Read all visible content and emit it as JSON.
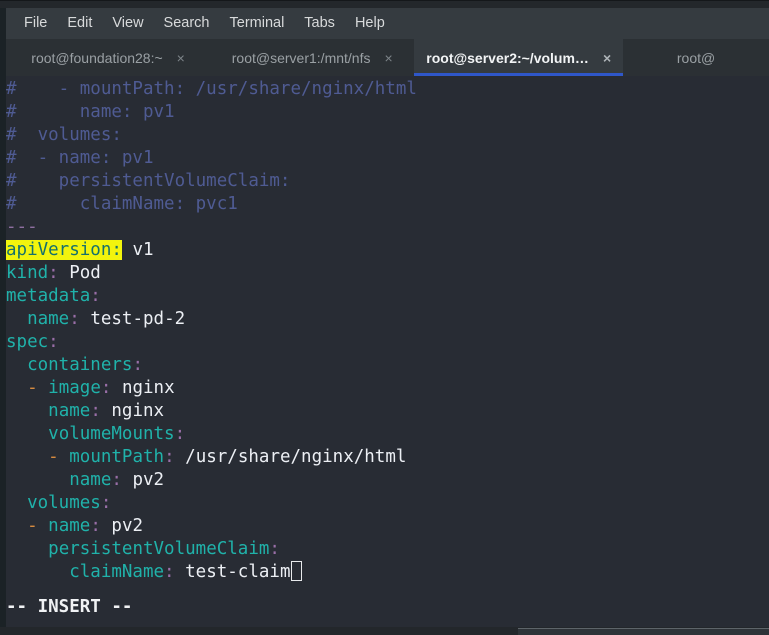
{
  "menubar": {
    "items": [
      {
        "label": "File",
        "name": "menu-file"
      },
      {
        "label": "Edit",
        "name": "menu-edit"
      },
      {
        "label": "View",
        "name": "menu-view"
      },
      {
        "label": "Search",
        "name": "menu-search"
      },
      {
        "label": "Terminal",
        "name": "menu-terminal"
      },
      {
        "label": "Tabs",
        "name": "menu-tabs"
      },
      {
        "label": "Help",
        "name": "menu-help"
      }
    ]
  },
  "tabbar": {
    "close_glyph": "×",
    "active_index": 2,
    "active_underline_color": "#2f57c9",
    "tabs": [
      {
        "label": "root@foundation28:~",
        "active": false
      },
      {
        "label": "root@server1:/mnt/nfs",
        "active": false
      },
      {
        "label": "root@server2:~/volum…",
        "active": true
      },
      {
        "label": "root@",
        "active": false
      }
    ]
  },
  "terminal": {
    "application": "vim",
    "mode_line": "-- INSERT --",
    "cursor_after_text": "test-claim",
    "colors": {
      "background": "#282c34",
      "comment": "#4f5b93",
      "key": "#20b2aa",
      "punctuation": "#9a6fa8",
      "dash": "#d68b40",
      "value": "#eceff4",
      "search_highlight_bg": "#f2f40d",
      "search_highlight_fg": "#15706c"
    },
    "search_match": "apiVersion:",
    "lines": [
      {
        "indent": 0,
        "segs": [
          {
            "t": "#    - mountPath: /usr/share/nginx/html",
            "c": "c-comment"
          }
        ]
      },
      {
        "indent": 0,
        "segs": [
          {
            "t": "#      name: pv1",
            "c": "c-comment"
          }
        ]
      },
      {
        "indent": 0,
        "segs": [
          {
            "t": "#  volumes:",
            "c": "c-comment"
          }
        ]
      },
      {
        "indent": 0,
        "segs": [
          {
            "t": "#  - name: pv1",
            "c": "c-comment"
          }
        ]
      },
      {
        "indent": 0,
        "segs": [
          {
            "t": "#    persistentVolumeClaim:",
            "c": "c-comment"
          }
        ]
      },
      {
        "indent": 0,
        "segs": [
          {
            "t": "#      claimName: pvc1",
            "c": "c-comment"
          }
        ]
      },
      {
        "indent": 0,
        "segs": [
          {
            "t": "---",
            "c": "c-doc"
          }
        ]
      },
      {
        "indent": 0,
        "segs": [
          {
            "t": "apiVersion:",
            "c": "c-search"
          },
          {
            "t": " v1",
            "c": "c-val"
          }
        ]
      },
      {
        "indent": 0,
        "segs": [
          {
            "t": "kind",
            "c": "c-key"
          },
          {
            "t": ":",
            "c": "c-punct"
          },
          {
            "t": " Pod",
            "c": "c-val"
          }
        ]
      },
      {
        "indent": 0,
        "segs": [
          {
            "t": "metadata",
            "c": "c-key"
          },
          {
            "t": ":",
            "c": "c-punct"
          }
        ]
      },
      {
        "indent": 0,
        "segs": [
          {
            "t": "  ",
            "c": "c-val"
          },
          {
            "t": "name",
            "c": "c-key"
          },
          {
            "t": ":",
            "c": "c-punct"
          },
          {
            "t": " test-pd-2",
            "c": "c-val"
          }
        ]
      },
      {
        "indent": 0,
        "segs": [
          {
            "t": "spec",
            "c": "c-key"
          },
          {
            "t": ":",
            "c": "c-punct"
          }
        ]
      },
      {
        "indent": 0,
        "segs": [
          {
            "t": "  ",
            "c": "c-val"
          },
          {
            "t": "containers",
            "c": "c-key"
          },
          {
            "t": ":",
            "c": "c-punct"
          }
        ]
      },
      {
        "indent": 0,
        "segs": [
          {
            "t": "  ",
            "c": "c-val"
          },
          {
            "t": "-",
            "c": "c-dash"
          },
          {
            "t": " ",
            "c": "c-val"
          },
          {
            "t": "image",
            "c": "c-key"
          },
          {
            "t": ":",
            "c": "c-punct"
          },
          {
            "t": " nginx",
            "c": "c-val"
          }
        ]
      },
      {
        "indent": 0,
        "segs": [
          {
            "t": "    ",
            "c": "c-val"
          },
          {
            "t": "name",
            "c": "c-key"
          },
          {
            "t": ":",
            "c": "c-punct"
          },
          {
            "t": " nginx",
            "c": "c-val"
          }
        ]
      },
      {
        "indent": 0,
        "segs": [
          {
            "t": "    ",
            "c": "c-val"
          },
          {
            "t": "volumeMounts",
            "c": "c-key"
          },
          {
            "t": ":",
            "c": "c-punct"
          }
        ]
      },
      {
        "indent": 0,
        "segs": [
          {
            "t": "    ",
            "c": "c-val"
          },
          {
            "t": "-",
            "c": "c-dash"
          },
          {
            "t": " ",
            "c": "c-val"
          },
          {
            "t": "mountPath",
            "c": "c-key"
          },
          {
            "t": ":",
            "c": "c-punct"
          },
          {
            "t": " /usr/share/nginx/html",
            "c": "c-val"
          }
        ]
      },
      {
        "indent": 0,
        "segs": [
          {
            "t": "      ",
            "c": "c-val"
          },
          {
            "t": "name",
            "c": "c-key"
          },
          {
            "t": ":",
            "c": "c-punct"
          },
          {
            "t": " pv2",
            "c": "c-val"
          }
        ]
      },
      {
        "indent": 0,
        "segs": [
          {
            "t": "  ",
            "c": "c-val"
          },
          {
            "t": "volumes",
            "c": "c-key"
          },
          {
            "t": ":",
            "c": "c-punct"
          }
        ]
      },
      {
        "indent": 0,
        "segs": [
          {
            "t": "  ",
            "c": "c-val"
          },
          {
            "t": "-",
            "c": "c-dash"
          },
          {
            "t": " ",
            "c": "c-val"
          },
          {
            "t": "name",
            "c": "c-key"
          },
          {
            "t": ":",
            "c": "c-punct"
          },
          {
            "t": " pv2",
            "c": "c-val"
          }
        ]
      },
      {
        "indent": 0,
        "segs": [
          {
            "t": "    ",
            "c": "c-val"
          },
          {
            "t": "persistentVolumeClaim",
            "c": "c-key"
          },
          {
            "t": ":",
            "c": "c-punct"
          }
        ]
      },
      {
        "indent": 0,
        "segs": [
          {
            "t": "      ",
            "c": "c-val"
          },
          {
            "t": "claimName",
            "c": "c-key"
          },
          {
            "t": ":",
            "c": "c-punct"
          },
          {
            "t": " test-claim",
            "c": "c-val"
          },
          {
            "t": "__CURSOR__",
            "c": "cursor"
          }
        ]
      }
    ]
  }
}
